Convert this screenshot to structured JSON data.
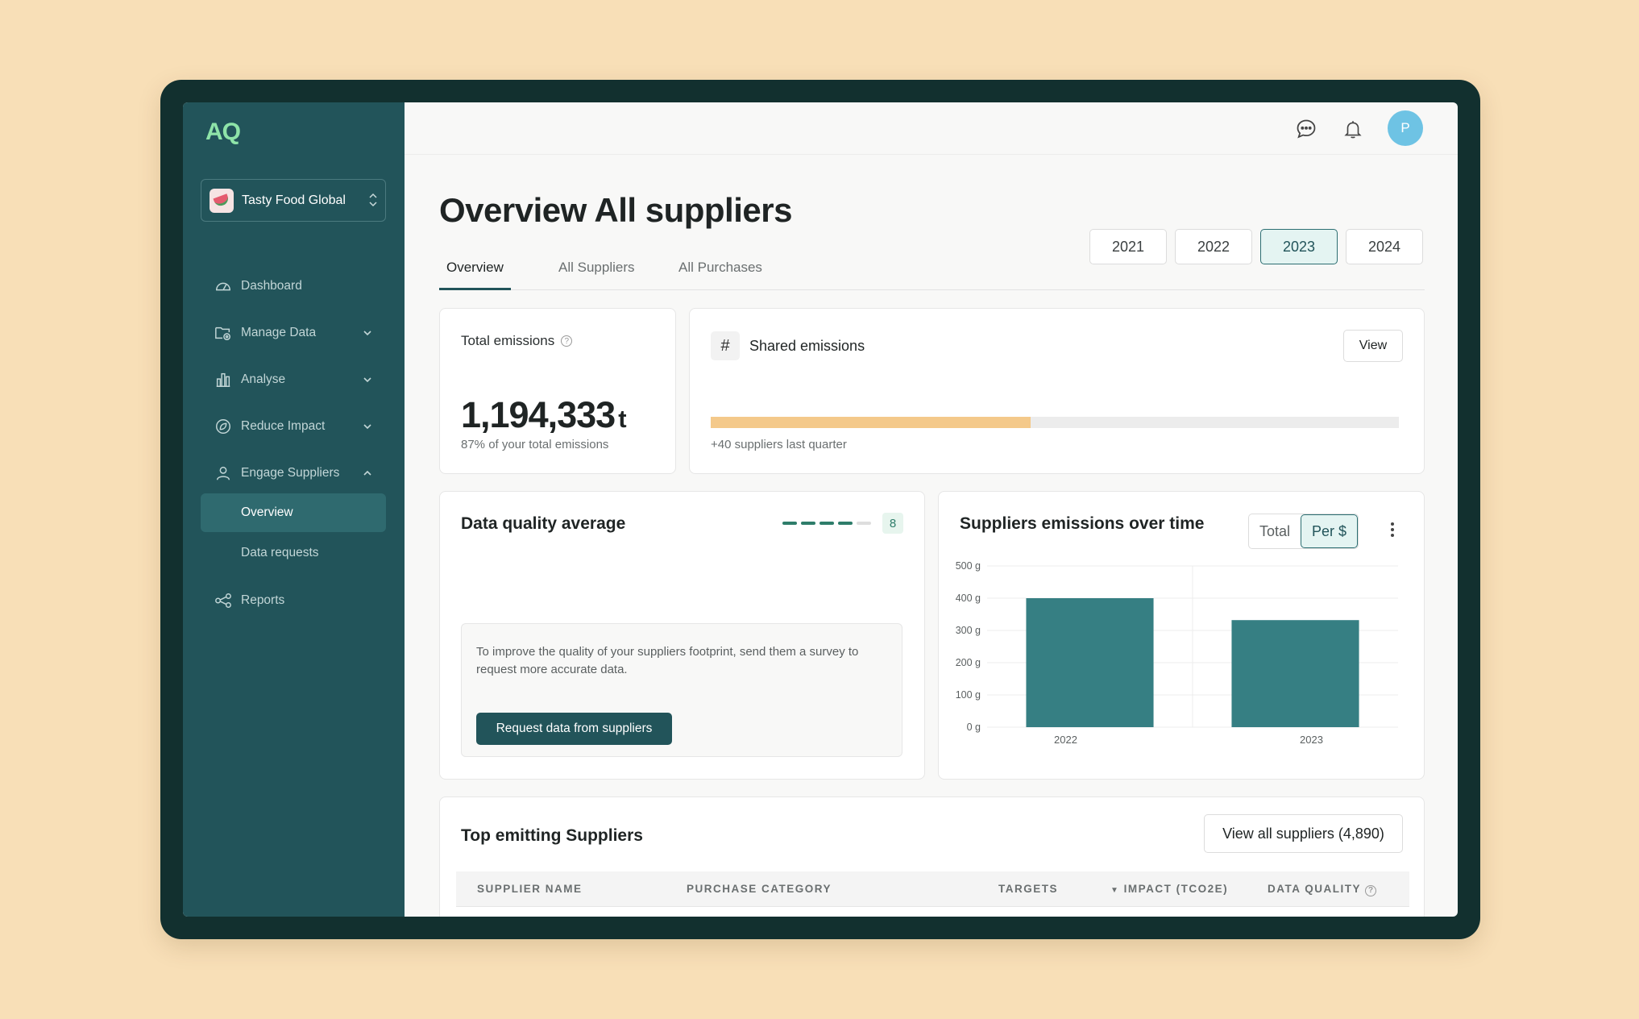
{
  "brand": {
    "logo": "AQ"
  },
  "org": {
    "name": "Tasty Food Global"
  },
  "sidebar": {
    "items": [
      {
        "label": "Dashboard"
      },
      {
        "label": "Manage Data"
      },
      {
        "label": "Analyse"
      },
      {
        "label": "Reduce Impact"
      },
      {
        "label": "Engage Suppliers"
      }
    ],
    "sub_items": [
      {
        "label": "Overview"
      },
      {
        "label": "Data requests"
      }
    ],
    "reports": {
      "label": "Reports"
    }
  },
  "user": {
    "initial": "P"
  },
  "page": {
    "title": "Overview All suppliers",
    "tabs": [
      {
        "label": "Overview"
      },
      {
        "label": "All Suppliers"
      },
      {
        "label": "All Purchases"
      }
    ],
    "years": [
      "2021",
      "2022",
      "2023",
      "2024"
    ],
    "selected_year": "2023"
  },
  "total_emissions": {
    "label": "Total emissions",
    "value": "1,194,333",
    "unit": "t",
    "sub": "87% of your total emissions"
  },
  "shared_emissions": {
    "icon": "#",
    "label": "Shared emissions",
    "view_label": "View",
    "progress": 0.465,
    "sub": "+40 suppliers last quarter"
  },
  "data_quality": {
    "title": "Data quality average",
    "score": "8",
    "filled_dashes": 4,
    "total_dashes": 5,
    "tip": "To improve the quality of your suppliers footprint, send them a survey to request more accurate data.",
    "button": "Request data from suppliers"
  },
  "emissions_chart": {
    "title": "Suppliers emissions over time",
    "toggle": [
      "Total",
      "Per $"
    ],
    "active_toggle": "Per $"
  },
  "chart_data": {
    "type": "bar",
    "categories": [
      "2022",
      "2023"
    ],
    "values": [
      400,
      332
    ],
    "ylim": [
      0,
      500
    ],
    "yticks": [
      "0 g",
      "100 g",
      "200 g",
      "300 g",
      "400 g",
      "500 g"
    ],
    "grid": true,
    "color": "#367f83"
  },
  "top_suppliers": {
    "title": "Top emitting Suppliers",
    "view_all": "View all suppliers (4,890)",
    "columns": [
      "SUPPLIER NAME",
      "PURCHASE CATEGORY",
      "TARGETS",
      "IMPACT (TCO2E)",
      "DATA QUALITY"
    ]
  },
  "colors": {
    "sidebar": "#22545a",
    "accent_green": "#8ee4a8",
    "bar_fill": "#f4c98a",
    "primary_button": "#22545a"
  }
}
